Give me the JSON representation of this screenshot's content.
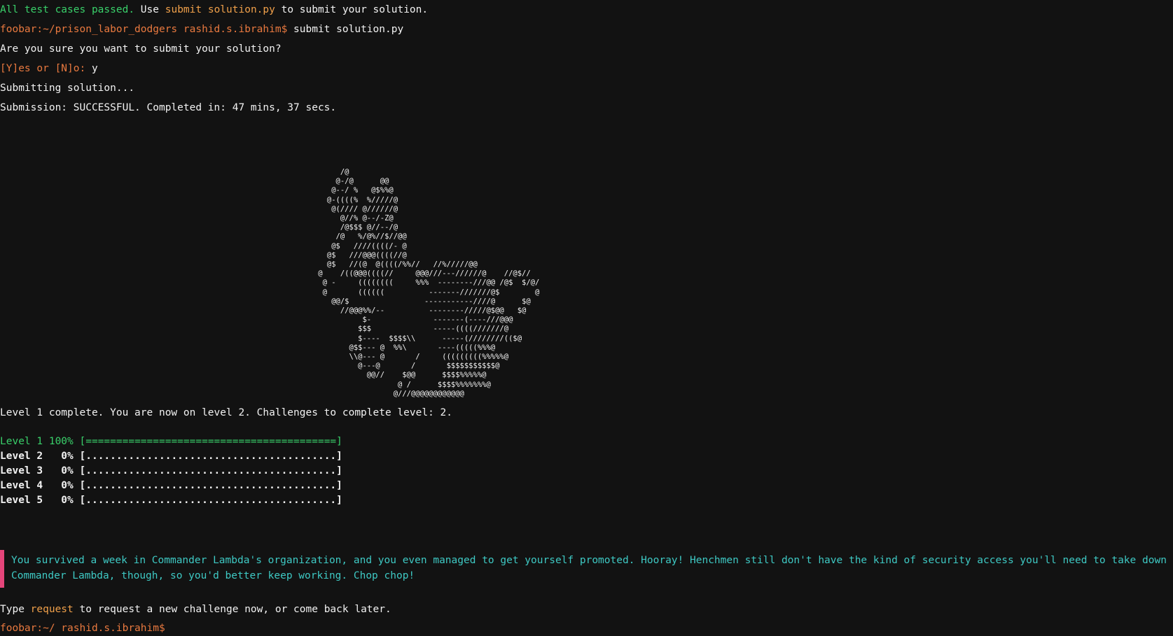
{
  "lines": {
    "tests_passed": "All test cases passed.",
    "use_word": "Use",
    "submit_cmd_hint": "submit solution.py",
    "to_submit_text": "to submit your solution.",
    "prompt1": "foobar:~/prison_labor_dodgers rashid.s.ibrahim$",
    "command1": "submit solution.py",
    "confirm_question": "Are you sure you want to submit your solution?",
    "yes_no_prompt": "[Y]es or [N]o:",
    "yes_no_answer": "y",
    "submitting": "Submitting solution...",
    "submission_result": "Submission: SUCCESSFUL. Completed in: 47 mins, 37 secs.",
    "level_complete": "Level 1 complete. You are now on level 2. Challenges to complete level: 2.",
    "type_word": "Type",
    "request_word": "request",
    "request_rest": "to request a new challenge now, or come back later.",
    "prompt2": "foobar:~/ rashid.s.ibrahim$"
  },
  "ascii_art": "            /@\n           @-/@      @@\n          @--/ %   @$%%@\n         @-((((%  %/////@\n          @(//// @//////@\n            @//% @--/-Z@\n            /@$$$ @//--/@\n           /@   %/@%//$//@@\n          @$   ////((((/- @\n         @$   ///@@@((((//@\n         @$   //(@  @((((/%%//   //%/////@@\n       @    /((@@@((((//     @@@///---//////@    //@$//\n        @ -     ((((((((     %%%  --------///@@ /@$  $/@/\n        @       ((((((          -------///////@$        @\n          @@/$                 -----------////@      $@\n            //@@@%%/--          --------/////@$@@   $@\n                 $-              -------(----///@@@\n                $$$              -----((((///////@\n                $----  $$$$\\\\      -----(////////(($@\n              @$$--- @  %%\\       ----(((((%%%@\n              \\\\@--- @       /     (((((((((%%%%%@\n                @---@       /       $$$$$$$$$$$@\n                  @@//    $@@      $$$$%%%%%@\n                         @ /      $$$$%%%%%%%@\n                        @///@@@@@@@@@@@@",
  "progress": {
    "levels": [
      {
        "label": "Level 1",
        "percent_text": "100%",
        "bar": "[=========================================]",
        "fraction": 1.0
      },
      {
        "label": "Level 2",
        "percent_text": "  0%",
        "bar": "[.........................................]",
        "fraction": 0.0
      },
      {
        "label": "Level 3",
        "percent_text": "  0%",
        "bar": "[.........................................]",
        "fraction": 0.0
      },
      {
        "label": "Level 4",
        "percent_text": "  0%",
        "bar": "[.........................................]",
        "fraction": 0.0
      },
      {
        "label": "Level 5",
        "percent_text": "  0%",
        "bar": "[.........................................]",
        "fraction": 0.0
      }
    ]
  },
  "banner": {
    "message": "You survived a week in Commander Lambda's organization, and you even managed to get yourself promoted. Hooray! Henchmen still don't have the kind of security access you'll need to take down Commander Lambda, though, so you'd better keep working. Chop chop!"
  },
  "colors": {
    "background": "#121212",
    "success_green": "#39d06a",
    "command_orange": "#f0a04a",
    "prompt_orange": "#e9793f",
    "message_cyan": "#3ec9c4",
    "accent_pink": "#e5457a"
  }
}
